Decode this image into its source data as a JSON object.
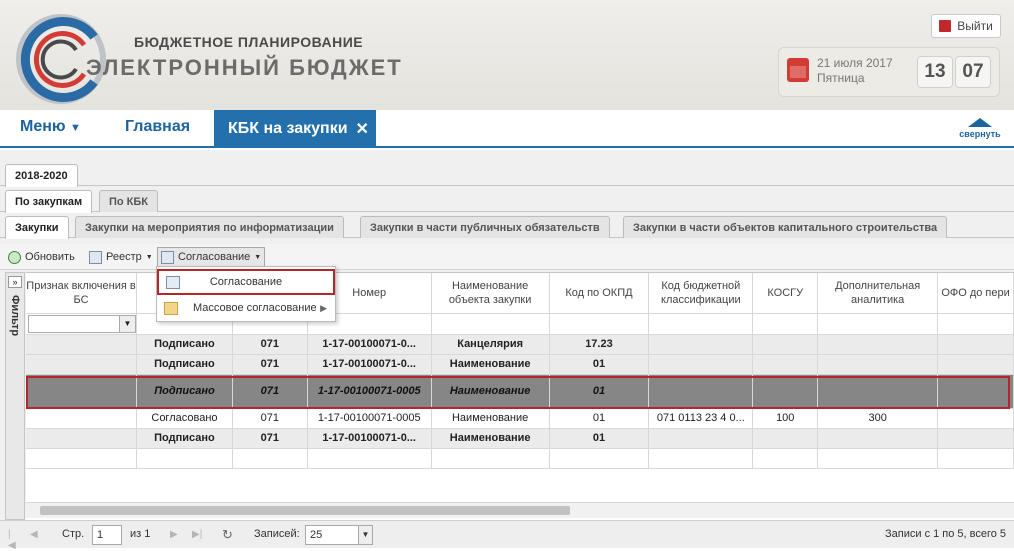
{
  "header": {
    "brand_line1": "БЮДЖЕТНОЕ ПЛАНИРОВАНИЕ",
    "brand_line2": "ЭЛЕКТРОННЫЙ БЮДЖЕТ",
    "logout_label": "Выйти",
    "date": "21 июля 2017",
    "weekday": "Пятница",
    "clock_hours": "13",
    "clock_minutes": "07",
    "accent_color": "#2370ad"
  },
  "nav": {
    "menu_label": "Меню",
    "home_label": "Главная",
    "active_tab": "КБК на закупки",
    "collapse_label": "свернуть"
  },
  "tabs": {
    "period": "2018-2020",
    "level2": [
      "По закупкам",
      "По КБК"
    ],
    "level3": [
      "Закупки",
      "Закупки на мероприятия по информатизации",
      "Закупки в части публичных обязательств",
      "Закупки в части объектов капитального строительства"
    ]
  },
  "toolbar": {
    "refresh": "Обновить",
    "registry": "Реестр",
    "approval": "Согласование"
  },
  "filter_label": "Фильтр",
  "menu": {
    "item1": "Согласование",
    "item2": "Массовое согласование"
  },
  "grid": {
    "columns": [
      "Признак включения в БС",
      "Номер",
      "Наименование объекта закупки",
      "Код по ОКПД",
      "Код бюджетной классификации",
      "КОСГУ",
      "Дополнительная аналитика",
      "ОФО до пери"
    ],
    "rows": [
      [
        "",
        "Подписано",
        "071",
        "1-17-00100071-0...",
        "Канцелярия",
        "17.23",
        "",
        "",
        "",
        ""
      ],
      [
        "",
        "Подписано",
        "071",
        "1-17-00100071-0...",
        "Наименование",
        "01",
        "",
        "",
        "",
        ""
      ],
      [
        "",
        "Подписано",
        "071",
        "1-17-00100071-0005",
        "Наименование",
        "01",
        "",
        "",
        "",
        ""
      ],
      [
        "",
        "Согласовано",
        "071",
        "1-17-00100071-0005",
        "Наименование",
        "01",
        "071 0113 23 4 0...",
        "100",
        "300",
        ""
      ],
      [
        "",
        "Подписано",
        "071",
        "1-17-00100071-0...",
        "Наименование",
        "01",
        "",
        "",
        "",
        ""
      ]
    ]
  },
  "pager": {
    "page_label": "Стр.",
    "page_value": "1",
    "of_label": "из 1",
    "records_label": "Записей:",
    "page_size": "25",
    "summary": "Записи с 1 по 5, всего 5"
  }
}
